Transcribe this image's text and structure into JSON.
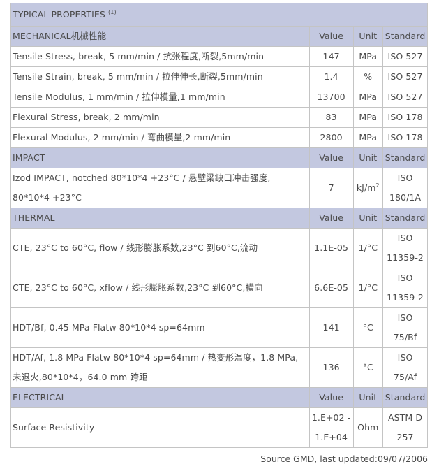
{
  "title": "TYPICAL PROPERTIES",
  "title_note": "(1)",
  "headers": {
    "value": "Value",
    "unit": "Unit",
    "standard": "Standard"
  },
  "sections": {
    "mechanical": {
      "name": "MECHANICAL机械性能",
      "rows": [
        {
          "property": "Tensile Stress, break, 5 mm/min / 抗张程度,断裂,5mm/min",
          "value": "147",
          "unit": "MPa",
          "standard": "ISO 527"
        },
        {
          "property": "Tensile Strain, break, 5 mm/min / 拉伸伸长,断裂,5mm/min",
          "value": "1.4",
          "unit": "%",
          "standard": "ISO 527"
        },
        {
          "property": "Tensile Modulus, 1 mm/min / 拉伸模量,1 mm/min",
          "value": "13700",
          "unit": "MPa",
          "standard": "ISO 527"
        },
        {
          "property": "Flexural Stress, break, 2 mm/min",
          "value": "83",
          "unit": "MPa",
          "standard": "ISO 178"
        },
        {
          "property": "Flexural Modulus, 2 mm/min / 弯曲模量,2 mm/min",
          "value": "2800",
          "unit": "MPa",
          "standard": "ISO 178"
        }
      ]
    },
    "impact": {
      "name": "IMPACT",
      "rows": [
        {
          "property": "Izod IMPACT, notched 80*10*4 +23°C / 悬壁梁缺口冲击强度, 80*10*4 +23°C",
          "value": "7",
          "unit_base": "kJ/m",
          "unit_sup": "2",
          "standard": "ISO 180/1A"
        }
      ]
    },
    "thermal": {
      "name": "THERMAL",
      "rows": [
        {
          "property": "CTE, 23°C to 60°C, flow / 线形膨胀系数,23°C 到60°C,流动",
          "value": "1.1E-05",
          "unit": "1/°C",
          "standard": "ISO 11359-2"
        },
        {
          "property": "CTE, 23°C to 60°C, xflow / 线形膨胀系数,23°C 到60°C,横向",
          "value": "6.6E-05",
          "unit": "1/°C",
          "standard": "ISO 11359-2"
        },
        {
          "property": "HDT/Bf, 0.45 MPa Flatw 80*10*4 sp=64mm",
          "value": "141",
          "unit": "°C",
          "standard": "ISO 75/Bf"
        },
        {
          "property": "HDT/Af, 1.8 MPa Flatw 80*10*4 sp=64mm / 热变形温度，1.8 MPa, 未退火,80*10*4，64.0 mm 跨距",
          "value": "136",
          "unit": "°C",
          "standard": "ISO 75/Af"
        }
      ]
    },
    "electrical": {
      "name": "ELECTRICAL",
      "rows": [
        {
          "property": "Surface Resistivity",
          "value": "1.E+02 - 1.E+04",
          "unit": "Ohm",
          "standard": "ASTM D 257"
        }
      ]
    }
  },
  "source_note": "Source GMD, last updated:09/07/2006"
}
